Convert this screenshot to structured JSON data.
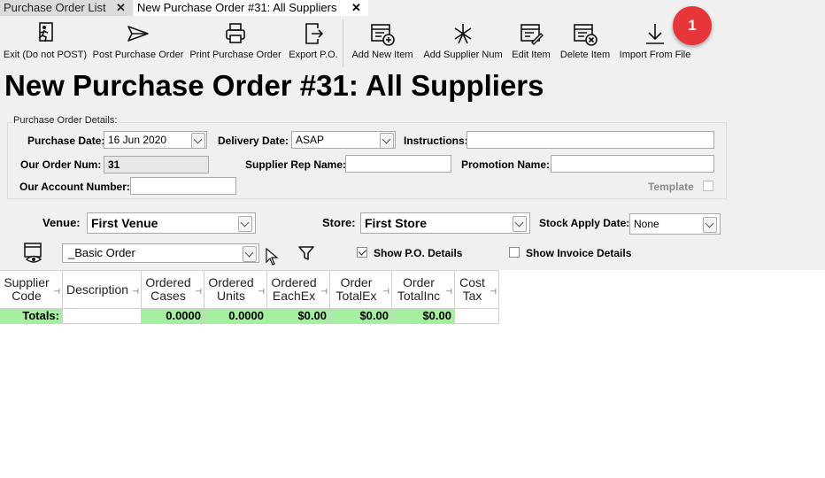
{
  "tabs": [
    {
      "label": "Purchase Order List",
      "close": "✕"
    },
    {
      "label": "New Purchase Order #31: All Suppliers",
      "close": "✕"
    }
  ],
  "toolbar": {
    "exit": {
      "label": "Exit (Do not POST)",
      "icon": "exit-running-man-icon"
    },
    "post": {
      "label": "Post Purchase Order",
      "icon": "send-arrow-icon"
    },
    "print": {
      "label": "Print Purchase Order",
      "icon": "printer-icon"
    },
    "export": {
      "label": "Export P.O.",
      "icon": "export-icon"
    },
    "add_item": {
      "label": "Add New Item",
      "icon": "add-item-icon"
    },
    "add_supplier_num": {
      "label": "Add Supplier Num",
      "icon": "asterisk-icon"
    },
    "edit_item": {
      "label": "Edit Item",
      "icon": "edit-item-icon"
    },
    "delete_item": {
      "label": "Delete Item",
      "icon": "delete-item-icon"
    },
    "import_file": {
      "label": "Import From File",
      "icon": "download-arrow-icon"
    }
  },
  "badge": "1",
  "page_title": "New Purchase Order #31: All Suppliers",
  "details": {
    "group_label": "Purchase Order Details:",
    "purchase_date_label": "Purchase Date:",
    "purchase_date": "16 Jun 2020",
    "delivery_date_label": "Delivery Date:",
    "delivery_date": "ASAP",
    "instructions_label": "Instructions:",
    "instructions": "",
    "order_num_label": "Our Order Num:",
    "order_num": "31",
    "supplier_rep_label": "Supplier Rep Name:",
    "supplier_rep": "",
    "promotion_label": "Promotion Name:",
    "promotion": "",
    "account_num_label": "Our Account Number:",
    "account_num": "",
    "template_label": "Template",
    "template_checked": false
  },
  "selectors": {
    "venue_label": "Venue:",
    "venue": "First Venue",
    "store_label": "Store:",
    "store": "First Store",
    "stock_apply_label": "Stock Apply Date:",
    "stock_apply": "None"
  },
  "view": {
    "layout": "_Basic Order",
    "show_po_details_label": "Show P.O. Details",
    "show_po_details": true,
    "show_invoice_details_label": "Show Invoice Details",
    "show_invoice_details": false,
    "pin_glyph": "⊣"
  },
  "grid": {
    "columns": [
      {
        "line1": "Supplier",
        "line2": "Code"
      },
      {
        "line1": "Description",
        "line2": ""
      },
      {
        "line1": "Ordered",
        "line2": "Cases"
      },
      {
        "line1": "Ordered",
        "line2": "Units"
      },
      {
        "line1": "Ordered",
        "line2": "EachEx"
      },
      {
        "line1": "Order",
        "line2": "TotalEx"
      },
      {
        "line1": "Order",
        "line2": "TotalInc"
      },
      {
        "line1": "Cost",
        "line2": "Tax"
      }
    ],
    "totals": [
      "Totals:",
      "",
      "0.0000",
      "0.0000",
      "$0.00",
      "$0.00",
      "$0.00",
      ""
    ]
  },
  "colors": {
    "badge": "#e8353a",
    "totals_green": "#a4f0a0"
  }
}
